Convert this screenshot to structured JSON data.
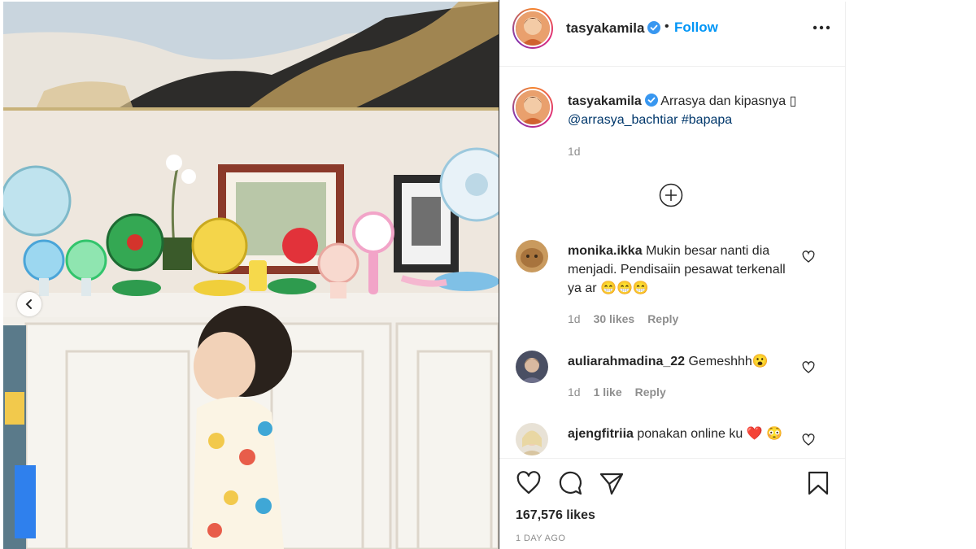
{
  "post": {
    "username": "tasyakamila",
    "follow_label": "Follow",
    "separator": "•",
    "caption_text": "Arrasya dan kipasnya ▯",
    "caption_mention": "@arrasya_bachtiar",
    "caption_hashtag": "#bapapa",
    "caption_time": "1d",
    "likes": "167,576 likes",
    "posted_ago": "1 DAY AGO"
  },
  "comments": [
    {
      "user": "monika.ikka",
      "text": "Mukin besar nanti dia menjadi. Pendisaiin pesawat terkenall ya ar 😁😁😁",
      "time": "1d",
      "likes": "30 likes",
      "reply": "Reply"
    },
    {
      "user": "auliarahmadina_22",
      "text": "Gemeshhh😮",
      "time": "1d",
      "likes": "1 like",
      "reply": "Reply"
    },
    {
      "user": "ajengfitriia",
      "text": "ponakan online ku ❤️ 😳",
      "time": "",
      "likes": "",
      "reply": ""
    }
  ],
  "icons": {
    "verified": "verified-badge-icon",
    "more": "more-options-icon",
    "load_more": "plus-circle-icon",
    "like": "heart-icon",
    "comment": "comment-icon",
    "share": "paper-plane-icon",
    "save": "bookmark-icon",
    "prev": "chevron-left-icon"
  },
  "colors": {
    "accent": "#0095f6",
    "link": "#00376b",
    "muted": "#8e8e8e",
    "text": "#262626",
    "verified": "#3897f0",
    "heart_red": "#d40000"
  }
}
